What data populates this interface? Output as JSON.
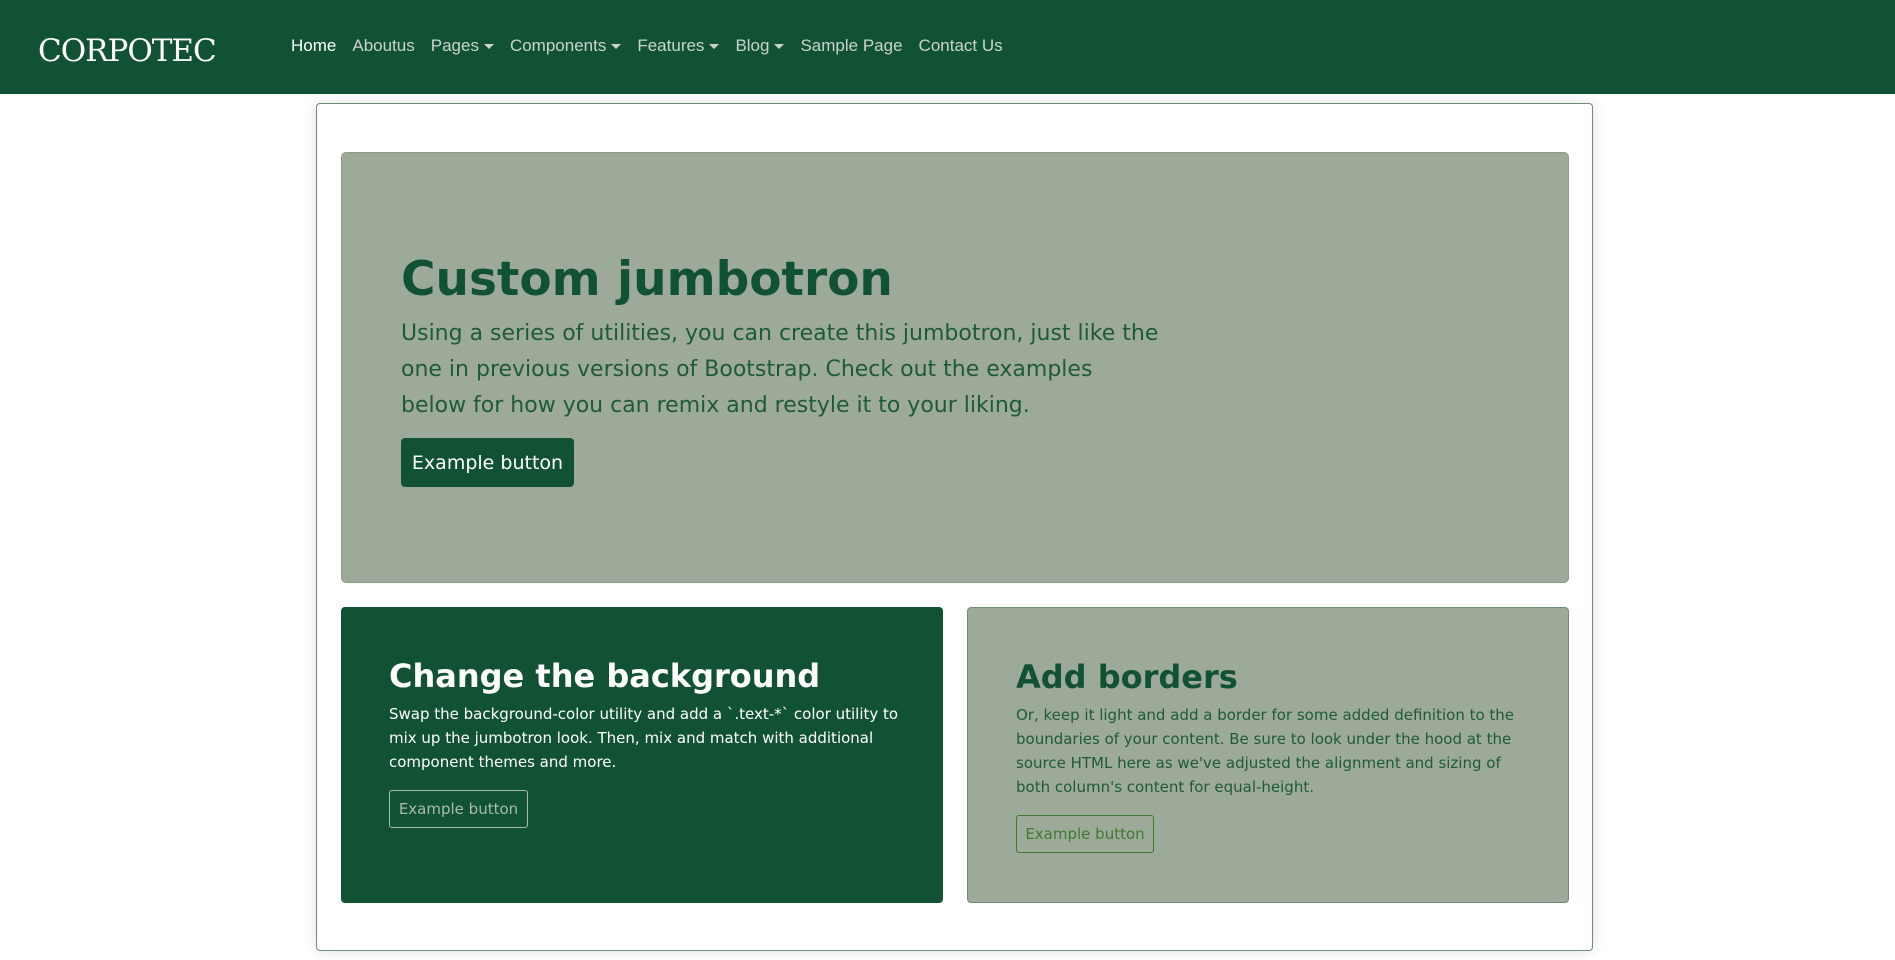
{
  "navbar": {
    "logo": "CORPOTEC",
    "items": [
      {
        "label": "Home",
        "active": true,
        "dropdown": false
      },
      {
        "label": "Aboutus",
        "active": false,
        "dropdown": false
      },
      {
        "label": "Pages",
        "active": false,
        "dropdown": true
      },
      {
        "label": "Components",
        "active": false,
        "dropdown": true
      },
      {
        "label": "Features",
        "active": false,
        "dropdown": true
      },
      {
        "label": "Blog",
        "active": false,
        "dropdown": true
      },
      {
        "label": "Sample Page",
        "active": false,
        "dropdown": false
      },
      {
        "label": "Contact Us",
        "active": false,
        "dropdown": false
      }
    ],
    "caret_icon": "chevron-down-icon"
  },
  "jumbotron": {
    "title": "Custom jumbotron",
    "text": "Using a series of utilities, you can create this jumbotron, just like the one in previous versions of Bootstrap. Check out the examples below for how you can remix and restyle it to your liking.",
    "button_label": "Example button"
  },
  "card_background": {
    "title": "Change the background",
    "text": "Swap the background-color utility and add a `.text-*` color utility to mix up the jumbotron look. Then, mix and match with additional component themes and more.",
    "button_label": "Example button"
  },
  "card_borders": {
    "title": "Add borders",
    "text": "Or, keep it light and add a border for some added definition to the boundaries of your content. Be sure to look under the hood at the source HTML here as we've adjusted the alignment and sizing of both column's content for equal-height.",
    "button_label": "Example button"
  },
  "colors": {
    "brand_dark_green": "#125234",
    "sage": "#9eaa99",
    "outline_green": "#3d7a2e"
  }
}
